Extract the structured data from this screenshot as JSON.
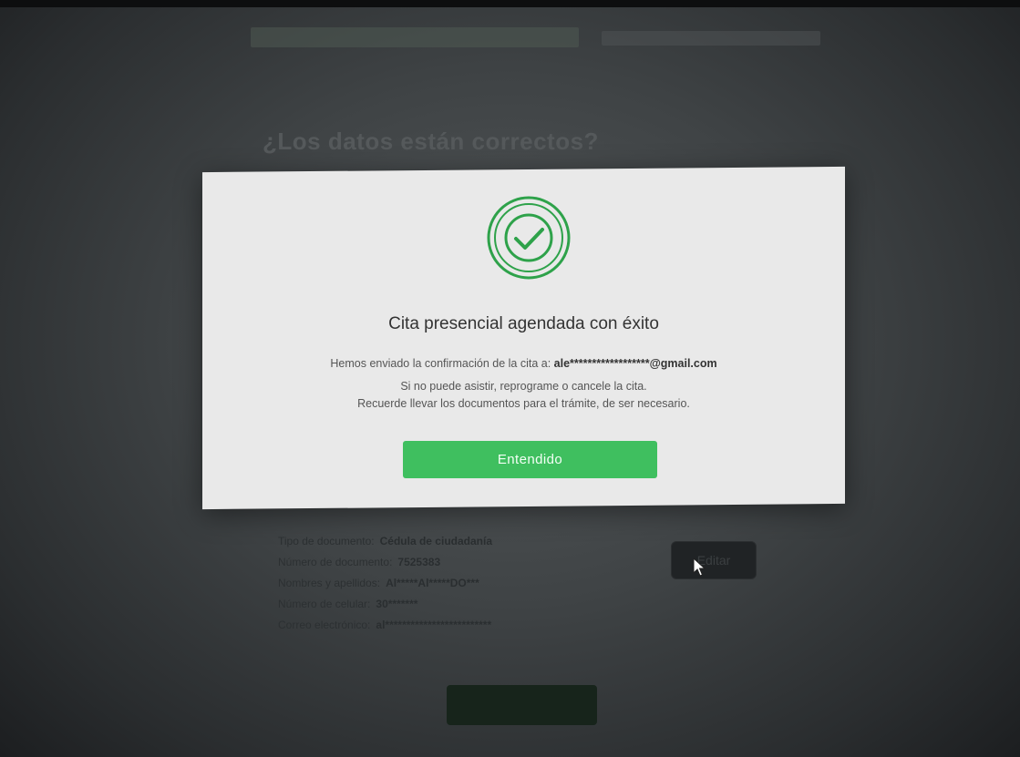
{
  "background_page": {
    "title": "¿Los datos están correctos?",
    "details": [
      {
        "label": "Tipo de documento:",
        "value": "Cédula de ciudadanía"
      },
      {
        "label": "Número de documento:",
        "value": "7525383"
      },
      {
        "label": "Nombres y apellidos:",
        "value": "Al*****Al*****DO***"
      },
      {
        "label": "Número de celular:",
        "value": "30*******"
      },
      {
        "label": "Correo electrónico:",
        "value": "al*************************"
      }
    ],
    "edit_label": "Editar"
  },
  "modal": {
    "icon": "check-circle-icon",
    "title": "Cita presencial agendada con éxito",
    "message_prefix": "Hemos enviado la confirmación de la cita a:",
    "email": "ale******************@gmail.com",
    "message_line2": "Si no puede asistir, reprograme o cancele la cita.",
    "message_line3": "Recuerde llevar los documentos para el trámite, de ser necesario.",
    "button_label": "Entendido"
  },
  "colors": {
    "accent": "#3fbf5f",
    "icon_green": "#2ea24a",
    "modal_bg": "#e9e9e9"
  }
}
